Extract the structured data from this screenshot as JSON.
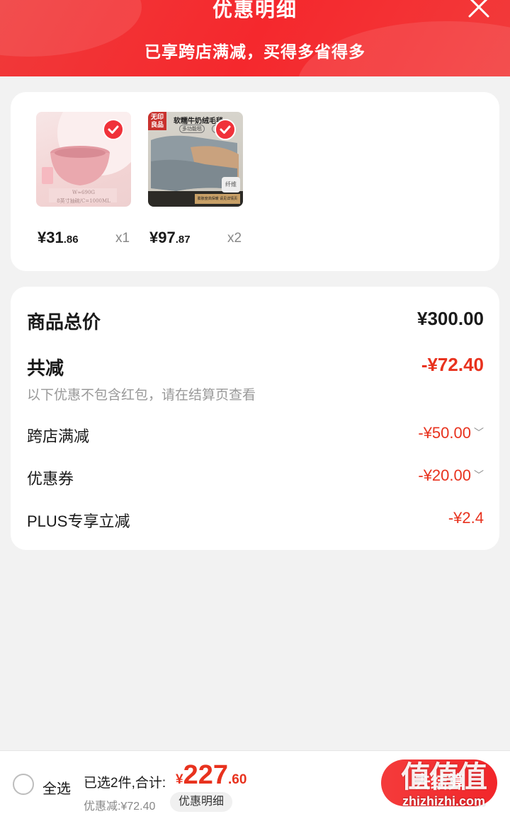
{
  "header": {
    "title": "优惠明细",
    "subtitle": "已享跨店满减，买得多省得多"
  },
  "products": [
    {
      "price_int": "¥31",
      "price_dec": ".86",
      "qty": "x1",
      "image_caption": "W≈690G",
      "image_caption2": "8英寸抽碗/C=1000ML"
    },
    {
      "price_int": "¥97",
      "price_dec": ".87",
      "qty": "x2",
      "image_badge": "无印良品",
      "image_title": "软糯牛奶绒毛毯",
      "image_tag1": "多功能毯",
      "image_tag2": "中毯",
      "image_tag3": "纤维",
      "image_footer": "膨胀度高保暖 请见详情页"
    }
  ],
  "summary": {
    "total_label": "商品总价",
    "total_value": "¥300.00",
    "reduce_label": "共减",
    "reduce_value": "-¥72.40",
    "note": "以下优惠不包含红包，请在结算页查看",
    "items": [
      {
        "label": "跨店满减",
        "value": "-¥50.00",
        "expandable": true
      },
      {
        "label": "优惠券",
        "value": "-¥20.00",
        "expandable": true
      },
      {
        "label": "PLUS专享立减",
        "value": "-¥2.4",
        "expandable": false
      }
    ]
  },
  "bottom": {
    "select_all": "全选",
    "selected_label": "已选2件,合计:",
    "total_currency": "¥",
    "total_int": "227",
    "total_dec": ".60",
    "discount_text": "优惠减:¥72.40",
    "detail_chip": "优惠明细",
    "checkout": "去结算"
  },
  "watermark": {
    "text": "值值值",
    "url": "zhizhizhi.com"
  },
  "colors": {
    "accent_red": "#f0323a",
    "price_red": "#e8321e"
  }
}
